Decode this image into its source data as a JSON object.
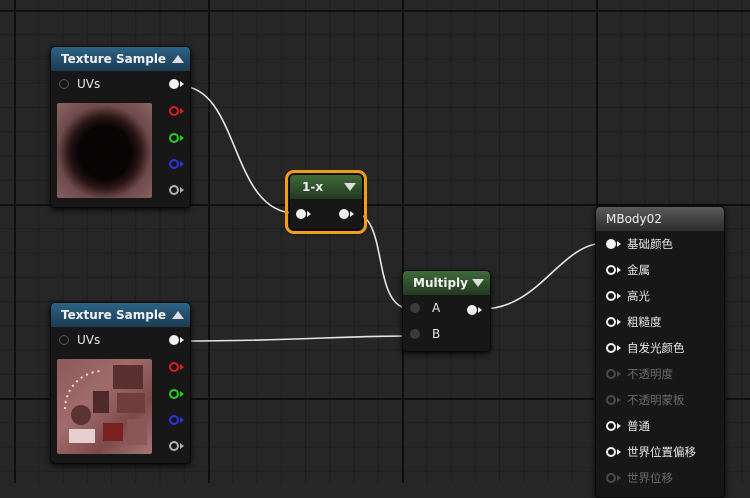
{
  "nodes": {
    "texture_sample_1": {
      "title": "Texture Sample",
      "input_label": "UVs"
    },
    "one_minus": {
      "title": "1-x"
    },
    "multiply": {
      "title": "Multiply",
      "inputs": [
        "A",
        "B"
      ]
    },
    "texture_sample_2": {
      "title": "Texture Sample",
      "input_label": "UVs"
    },
    "material": {
      "title": "MBody02",
      "inputs": [
        {
          "label": "基础颜色",
          "enabled": true,
          "connected": true
        },
        {
          "label": "金属",
          "enabled": true,
          "connected": false
        },
        {
          "label": "高光",
          "enabled": true,
          "connected": false
        },
        {
          "label": "粗糙度",
          "enabled": true,
          "connected": false
        },
        {
          "label": "自发光颜色",
          "enabled": true,
          "connected": false
        },
        {
          "label": "不透明度",
          "enabled": false,
          "connected": false
        },
        {
          "label": "不透明蒙板",
          "enabled": false,
          "connected": false
        },
        {
          "label": "普通",
          "enabled": true,
          "connected": false
        },
        {
          "label": "世界位置偏移",
          "enabled": true,
          "connected": false
        },
        {
          "label": "世界位移",
          "enabled": false,
          "connected": false
        }
      ]
    }
  },
  "colors": {
    "pin_white": "#f0f0f0",
    "pin_red": "#d92020",
    "pin_green": "#21d121",
    "pin_blue": "#2a35e0",
    "pin_gray": "#b0b0b0",
    "selection": "#f29d17",
    "wire": "#e6e6e6"
  }
}
